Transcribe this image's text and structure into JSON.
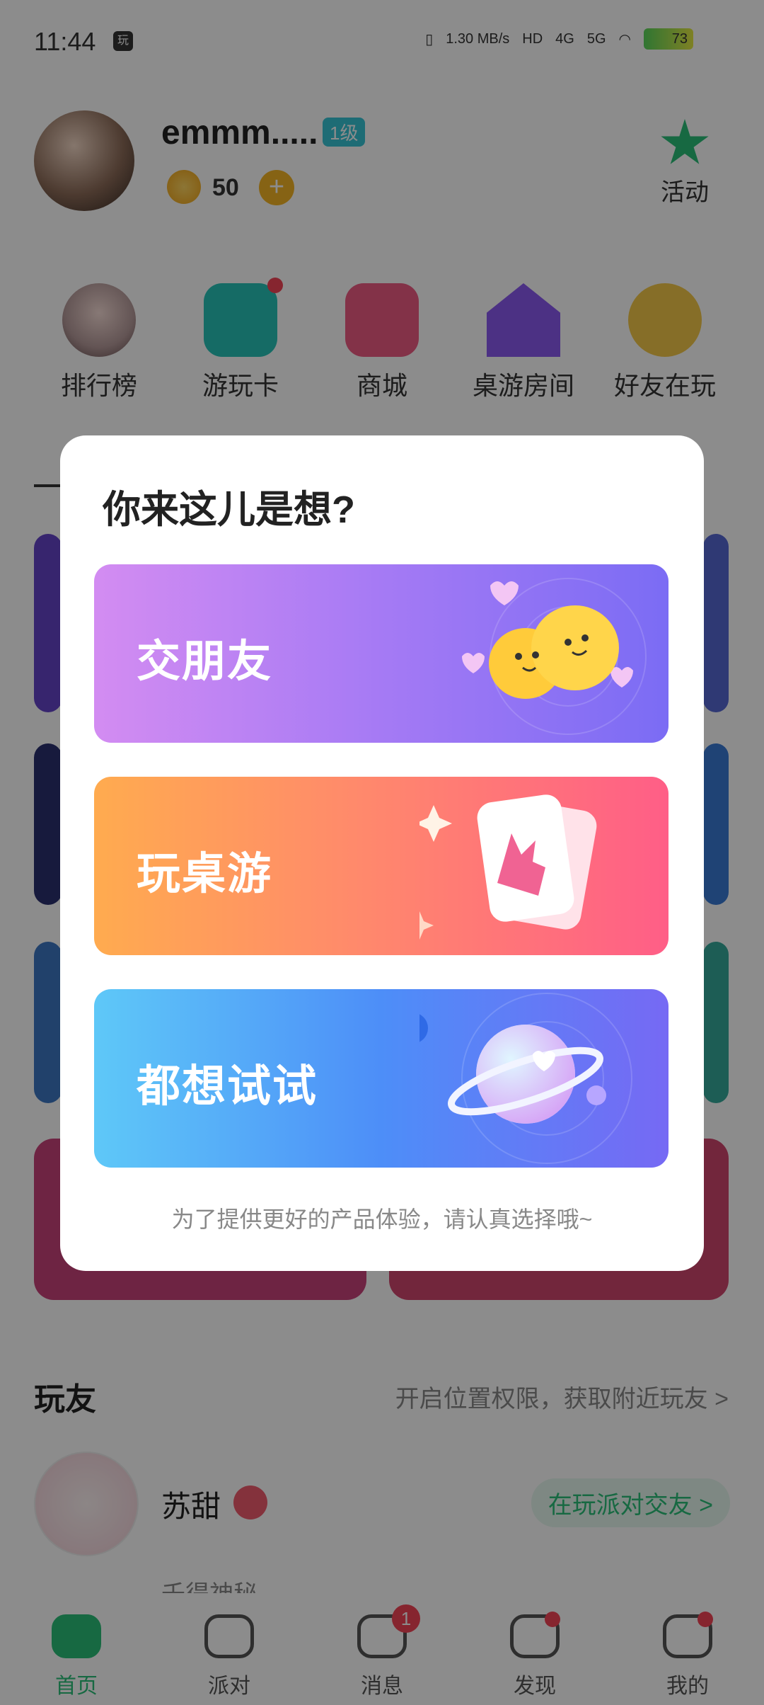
{
  "status_bar": {
    "time": "11:44",
    "app_indicator": "玩",
    "net_speed": "1.30 MB/s",
    "hd": "HD",
    "net_4g": "4G",
    "net_5g": "5G",
    "battery": "73"
  },
  "profile": {
    "username": "emmm.....",
    "level": "1级",
    "coins": "50",
    "plus": "+",
    "activity_label": "活动"
  },
  "quick_links": [
    {
      "label": "排行榜"
    },
    {
      "label": "游玩卡"
    },
    {
      "label": "商城"
    },
    {
      "label": "桌游房间"
    },
    {
      "label": "好友在玩"
    }
  ],
  "section": {
    "title": "玩友",
    "location_hint": "开启位置权限，获取附近玩友",
    "chevron": ">"
  },
  "friend": {
    "name": "苏甜",
    "status": "在玩派对交友 >",
    "subtitle": "千得神秘"
  },
  "bottom_nav": [
    {
      "label": "首页",
      "active": true
    },
    {
      "label": "派对"
    },
    {
      "label": "消息",
      "badge": "1"
    },
    {
      "label": "发现",
      "dot": true
    },
    {
      "label": "我的",
      "dot": true
    }
  ],
  "modal": {
    "title": "你来这儿是想?",
    "choices": [
      {
        "label": "交朋友",
        "colors": [
          "#d38cf2",
          "#7b6cf4"
        ]
      },
      {
        "label": "玩桌游",
        "colors": [
          "#ffab4f",
          "#ff5e87"
        ]
      },
      {
        "label": "都想试试",
        "colors": [
          "#5ec8f8",
          "#7669f4"
        ]
      }
    ],
    "hint": "为了提供更好的产品体验，请认真选择哦~"
  },
  "colors": {
    "accent": "#2bbf79",
    "badge_red": "#f44456"
  }
}
